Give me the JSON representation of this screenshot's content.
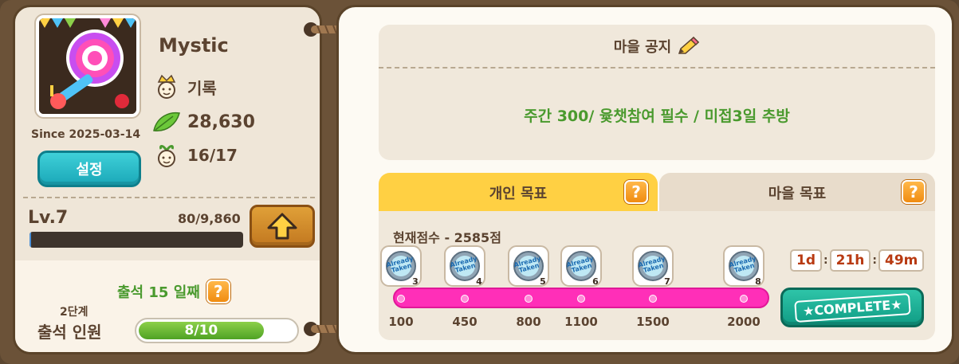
{
  "profile": {
    "username": "Mystic",
    "record_label": "기록",
    "leaves": "28,630",
    "members": "16/17",
    "since": "Since 2025-03-14",
    "settings_label": "설정"
  },
  "level": {
    "label": "Lv.7",
    "exp_text": "80/9,860",
    "exp_fraction": 0.008
  },
  "attendance": {
    "title": "출석 15 일째",
    "help": "?",
    "stage": "2단계",
    "label": "출석 인원",
    "progress_text": "8/10",
    "progress_fraction": 0.8
  },
  "notice": {
    "title": "마을 공지",
    "text": "주간 300/ 윷챗참여 필수 / 미접3일 추방"
  },
  "tabs": {
    "personal": "개인 목표",
    "village": "마을 목표",
    "help": "?"
  },
  "goal": {
    "score_text": "현재점수 - 2585점",
    "milestones": [
      {
        "label": "100",
        "badge": "Already Taken",
        "num": "3"
      },
      {
        "label": "450",
        "badge": "Already Taken",
        "num": "4"
      },
      {
        "label": "800",
        "badge": "Already Taken",
        "num": "5"
      },
      {
        "label": "1100",
        "badge": "Already Taken",
        "num": "6"
      },
      {
        "label": "1500",
        "badge": "Already Taken",
        "num": "7"
      },
      {
        "label": "2000",
        "badge": "Already Taken",
        "num": "8"
      }
    ],
    "timer": {
      "days": "1d",
      "hours": "21h",
      "minutes": "49m"
    },
    "complete_label": "COMPLETE"
  },
  "colors": {
    "accent_green": "#4a9a2e",
    "track_pink": "#ff2fb8",
    "tab_yellow": "#ffd043",
    "button_teal": "#1aa8b8"
  }
}
